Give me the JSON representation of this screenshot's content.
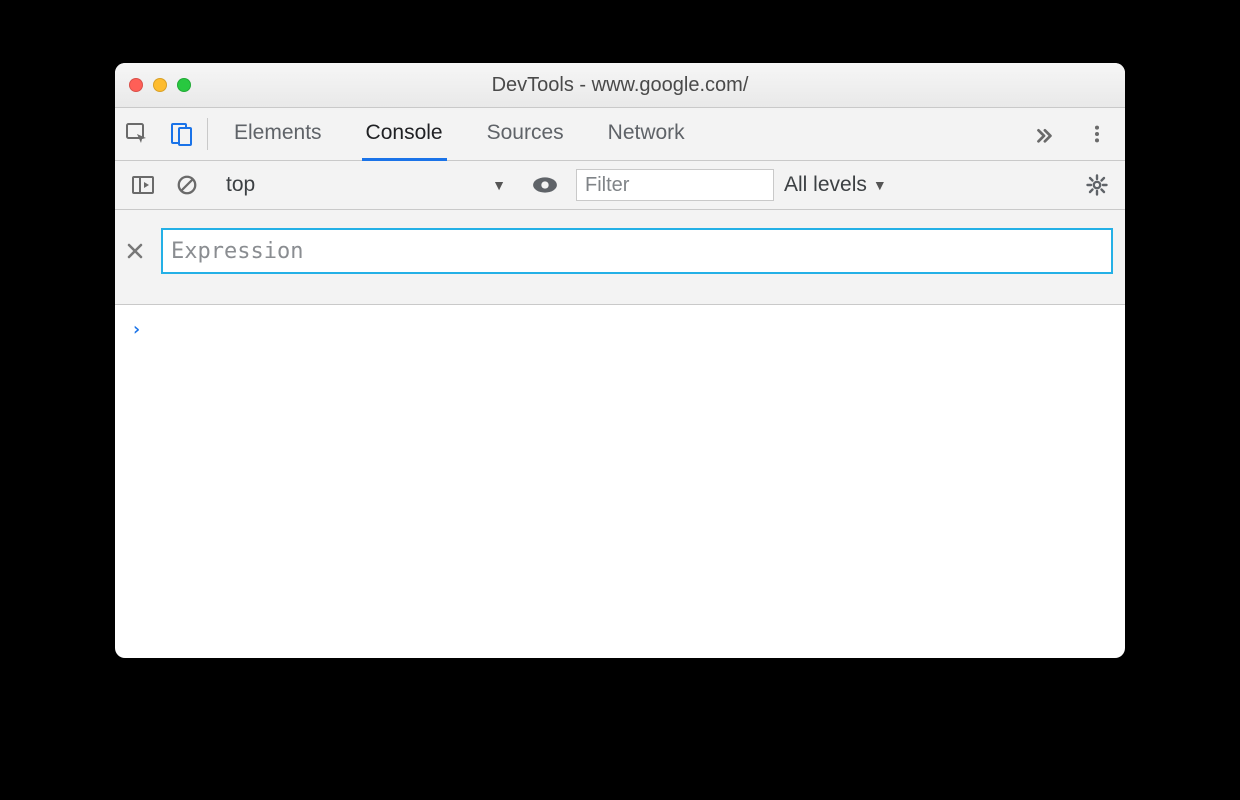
{
  "window": {
    "title": "DevTools - www.google.com/"
  },
  "tabs": {
    "items": [
      "Elements",
      "Console",
      "Sources",
      "Network"
    ],
    "active_index": 1
  },
  "console_toolbar": {
    "context": "top",
    "filter_placeholder": "Filter",
    "levels_label": "All levels"
  },
  "live_expression": {
    "placeholder": "Expression",
    "value": ""
  },
  "console": {
    "prompt_symbol": "›"
  }
}
